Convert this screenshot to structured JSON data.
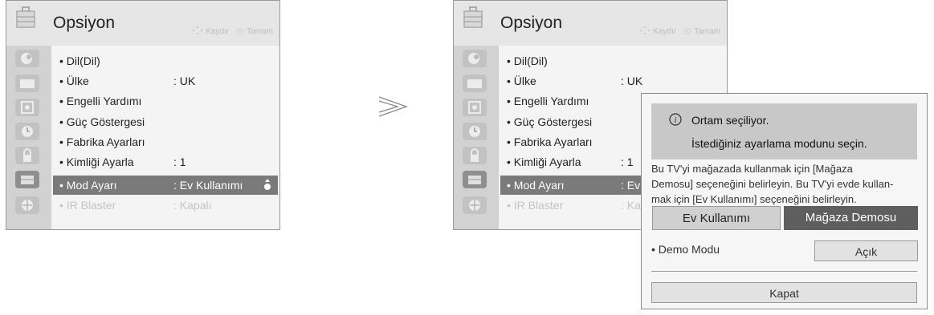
{
  "left_panel": {
    "title": "Opsiyon",
    "hint_move": "Kaydır",
    "hint_ok": "Tamam",
    "items": [
      {
        "label": "• Dil(Dil)",
        "value": ""
      },
      {
        "label": "• Ülke",
        "value": ": UK"
      },
      {
        "label": "• Engelli Yardımı",
        "value": ""
      },
      {
        "label": "• Güç Göstergesi",
        "value": ""
      },
      {
        "label": "• Fabrika Ayarları",
        "value": ""
      },
      {
        "label": "• Kimliği Ayarla",
        "value": ": 1"
      },
      {
        "label": "• Mod Ayarı",
        "value": ": Ev Kullanımı"
      },
      {
        "label": "• IR Blaster",
        "value": ": Kapalı"
      }
    ]
  },
  "right_panel": {
    "title": "Opsiyon",
    "hint_move": "Kaydır",
    "hint_ok": "Tamam",
    "items": [
      {
        "label": "• Dil(Dil)",
        "value": ""
      },
      {
        "label": "• Ülke",
        "value": ": UK"
      },
      {
        "label": "• Engelli Yardımı",
        "value": ""
      },
      {
        "label": "• Güç Göstergesi",
        "value": ""
      },
      {
        "label": "• Fabrika Ayarları",
        "value": ""
      },
      {
        "label": "• Kimliği Ayarla",
        "value": ": 1"
      },
      {
        "label": "• Mod Ayarı",
        "value": ": Ev"
      },
      {
        "label": "• IR Blaster",
        "value": ": Kap"
      }
    ]
  },
  "dialog": {
    "line1": "Ortam seçiliyor.",
    "line2": "İstediğiniz ayarlama modunu seçin.",
    "body_lines": [
      "Bu TV'yi mağazada kullanmak için [Mağaza",
      "Demosu] seçeneğini belirleyin. Bu TV'yi evde kullan-",
      "mak için [Ev Kullanımı] seçeneğini belirleyin."
    ],
    "btn_home": "Ev Kullanımı",
    "btn_store": "Mağaza Demosu",
    "demo_label": "• Demo Modu",
    "demo_value": "Açık",
    "close": "Kapat"
  },
  "icons": {
    "header": "toolbox-icon",
    "sidebar": [
      "picture-icon",
      "monitor-icon",
      "speaker-icon",
      "clock-icon",
      "lock-icon",
      "option-icon",
      "network-icon"
    ],
    "dialog": "info-icon",
    "transition": "next-arrow-icon",
    "selected_indicator": "scroll-indicator-icon"
  },
  "colors": {
    "selected_bg": "#7a7a7a",
    "store_button_bg": "#5e5e5e"
  }
}
